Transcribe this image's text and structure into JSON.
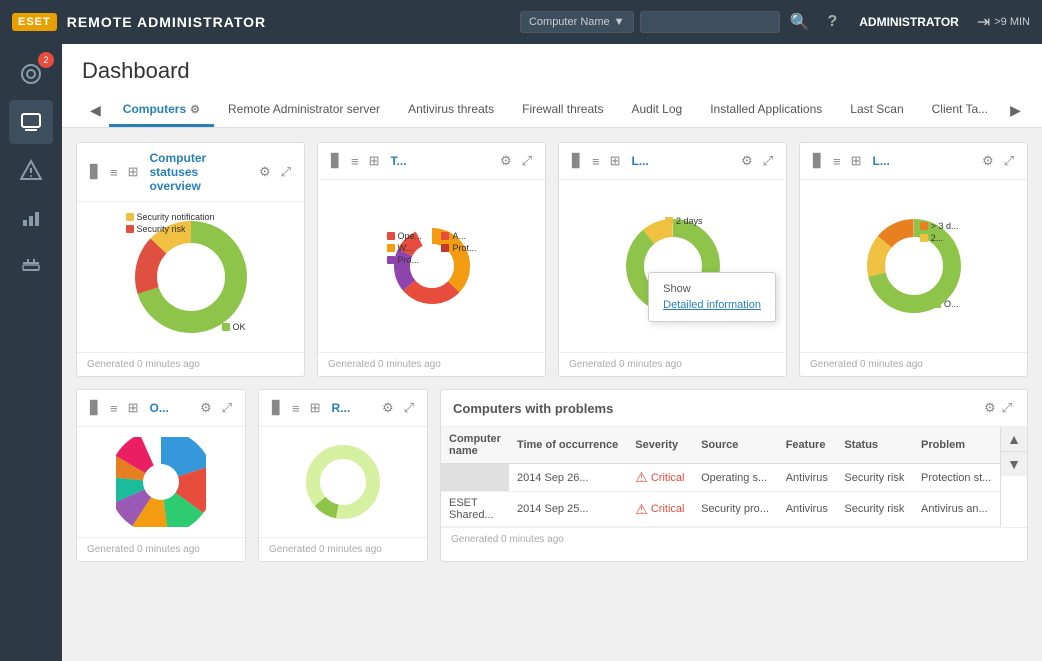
{
  "topbar": {
    "logo": "ESET",
    "title": "REMOTE ADMINISTRATOR",
    "filter_label": "Computer Name",
    "search_placeholder": "",
    "help_icon": "?",
    "user": "ADMINISTRATOR",
    "session": ">9 MIN"
  },
  "sidebar": {
    "badge": "2",
    "items": [
      {
        "id": "dashboard",
        "icon": "⊙",
        "label": "Dashboard"
      },
      {
        "id": "computers",
        "icon": "⬜",
        "label": "Computers"
      },
      {
        "id": "alerts",
        "icon": "⚠",
        "label": "Alerts"
      },
      {
        "id": "reports",
        "icon": "📊",
        "label": "Reports"
      },
      {
        "id": "tools",
        "icon": "🧰",
        "label": "Tools"
      }
    ]
  },
  "page": {
    "title": "Dashboard"
  },
  "tabs": [
    {
      "id": "computers",
      "label": "Computers",
      "active": true,
      "has_settings": true
    },
    {
      "id": "remote-admin",
      "label": "Remote Administrator server",
      "active": false
    },
    {
      "id": "antivirus",
      "label": "Antivirus threats",
      "active": false
    },
    {
      "id": "firewall",
      "label": "Firewall threats",
      "active": false
    },
    {
      "id": "audit-log",
      "label": "Audit Log",
      "active": false
    },
    {
      "id": "installed-apps",
      "label": "Installed Applications",
      "active": false
    },
    {
      "id": "last-scan",
      "label": "Last Scan",
      "active": false
    },
    {
      "id": "client-tasks",
      "label": "Client Ta...",
      "active": false
    }
  ],
  "widgets": {
    "computer_statuses": {
      "title": "Computer statuses overview",
      "footer": "Generated 0 minutes ago",
      "legend": [
        {
          "label": "Security notification",
          "color": "#f0c040"
        },
        {
          "label": "Security risk",
          "color": "#e05040"
        },
        {
          "label": "OK",
          "color": "#8ec44a"
        }
      ],
      "chart": {
        "segments": [
          {
            "color": "#8ec44a",
            "pct": 70
          },
          {
            "color": "#e05040",
            "pct": 17
          },
          {
            "color": "#f0c040",
            "pct": 13
          }
        ]
      }
    },
    "antivirus_threats": {
      "title": "T...",
      "footer": "Generated 0 minutes ago",
      "legend": [
        {
          "label": "Ope...",
          "color": "#c0392b"
        },
        {
          "label": "W...",
          "color": "#f39c12"
        },
        {
          "label": "Pro...",
          "color": "#8e44ad"
        },
        {
          "label": "A...",
          "color": "#e74c3c"
        },
        {
          "label": "Prot...",
          "color": "#e74c3c"
        }
      ]
    },
    "last_scan": {
      "title": "L...",
      "footer": "Generated 0 minutes ago",
      "tooltip": {
        "label": "Show",
        "link": "Detailed information"
      },
      "legend": [
        {
          "label": "2 days",
          "color": "#f0c040"
        }
      ]
    },
    "widget4": {
      "title": "L...",
      "footer": "Generated 0 minutes ago",
      "legend": [
        {
          "label": "> 3 d...",
          "color": "#e88020"
        },
        {
          "label": "2...",
          "color": "#f0c040"
        },
        {
          "label": "O...",
          "color": "#8ec44a"
        }
      ]
    },
    "widget5": {
      "title": "O...",
      "footer": "Generated 0 minutes ago"
    },
    "widget6": {
      "title": "R...",
      "footer": "Generated 0 minutes ago"
    }
  },
  "problems_widget": {
    "title": "Computers with problems",
    "columns": [
      "Computer name",
      "Time of occurrence",
      "Severity",
      "Source",
      "Feature",
      "Status",
      "Problem"
    ],
    "rows": [
      {
        "computer": "",
        "time": "2014 Sep 26...",
        "severity": "Critical",
        "source": "Operating s...",
        "feature": "Antivirus",
        "status": "Security risk",
        "problem": "Protection st..."
      },
      {
        "computer": "ESET Shared...",
        "time": "2014 Sep 25...",
        "severity": "Critical",
        "source": "Security pro...",
        "feature": "Antivirus",
        "status": "Security risk",
        "problem": "Antivirus an..."
      }
    ],
    "footer": "Generated 0 minutes ago"
  }
}
